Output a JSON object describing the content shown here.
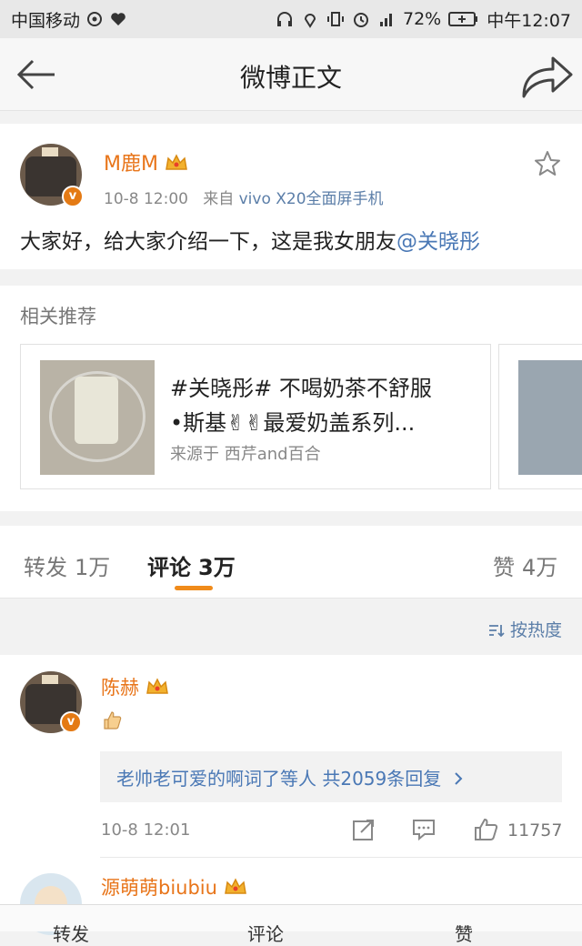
{
  "status_bar": {
    "carrier": "中国移动",
    "battery": "72%",
    "time": "中午12:07"
  },
  "header": {
    "title": "微博正文"
  },
  "post": {
    "username": "M鹿M",
    "time": "10-8 12:00",
    "source_prefix": "来自",
    "device": "vivo X20全面屏手机",
    "text": "大家好，给大家介绍一下，这是我女朋友",
    "mention": "@关晓彤"
  },
  "recommend": {
    "heading": "相关推荐",
    "card": {
      "line1": "#关晓彤# 不喝奶茶不舒服",
      "line2": "•斯基✌✌最爱奶盖系列...",
      "from": "来源于 西芹and百合"
    }
  },
  "tabs": {
    "repost_label": "转发",
    "repost_count": "1万",
    "comment_label": "评论",
    "comment_count": "3万",
    "like_label": "赞",
    "like_count": "4万"
  },
  "sort": {
    "label": "按热度"
  },
  "comments": [
    {
      "name": "陈赫",
      "replies_text": "老帅老可爱的啊词了等人 共2059条回复",
      "time": "10-8 12:01",
      "likes": "11757"
    },
    {
      "name": "源萌萌biubiu"
    }
  ],
  "bottom_bar": {
    "repost": "转发",
    "comment": "评论",
    "like": "赞"
  },
  "colors": {
    "accent_orange": "#e8751a",
    "link_blue": "#4a78b5",
    "tab_underline": "#f08b1a"
  }
}
